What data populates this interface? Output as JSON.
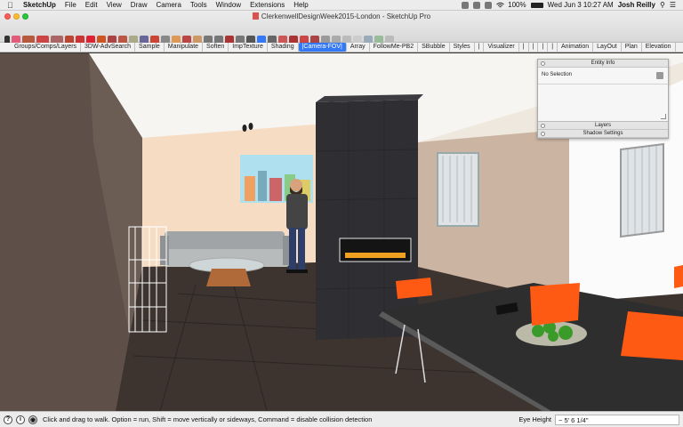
{
  "menubar": {
    "app_name": "SketchUp",
    "items": [
      "File",
      "Edit",
      "View",
      "Draw",
      "Camera",
      "Tools",
      "Window",
      "Extensions",
      "Help"
    ],
    "battery": "100%",
    "datetime": "Wed Jun 3  10:27 AM",
    "user": "Josh Reilly"
  },
  "window": {
    "title": "ClerkenwellDesignWeek2015-London - SketchUp Pro"
  },
  "extension_toolbar": {
    "items": [
      "Groups/Comps/Layers",
      "3DW-AdvSearch",
      "Sample",
      "Manipulate",
      "Soften",
      "ImpTexture",
      "Shading",
      "|Camera-FOV|",
      "Array",
      "FollowMe-PB2",
      "SBubble",
      "Styles",
      "|",
      "Visualizer",
      "|",
      "|",
      "|",
      "|",
      "Animation",
      "LayOut",
      "Plan",
      "Elevation"
    ],
    "active_index": 7
  },
  "entity_info": {
    "title": "Entity Info",
    "selection": "No Selection"
  },
  "trays": {
    "layers": "Layers",
    "shadow_settings": "Shadow Settings"
  },
  "statusbar": {
    "hint": "Click and drag to walk.  Option = run, Shift = move vertically or sideways, Command = disable collision detection",
    "measure_label": "Eye Height",
    "measure_value": "~ 5' 6 1/4\""
  },
  "colors": {
    "accent": "#3478f6",
    "fireplace": "#2f2f33",
    "chair_orange": "#ff5a14",
    "wall_peach": "#f7dcc4",
    "floor": "#3d342f"
  },
  "icons": [
    "apple-icon",
    "wifi-icon",
    "battery-icon",
    "search-icon",
    "walk-icon",
    "info-icon",
    "footprints-icon"
  ]
}
